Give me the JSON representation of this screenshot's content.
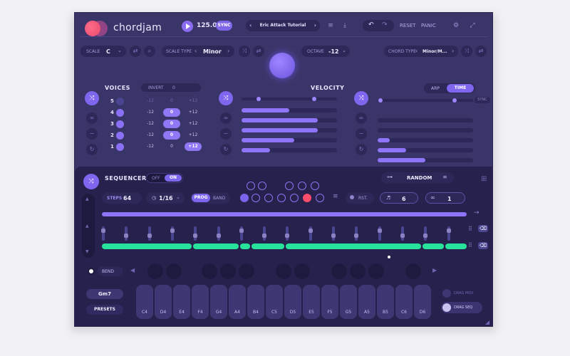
{
  "app": {
    "name": "chordjam"
  },
  "header": {
    "tempo": "125.00",
    "sync_label": "SYNC",
    "preset_name": "Eric Attack Tutorial",
    "reset_label": "RESET",
    "panic_label": "PANIC"
  },
  "controls": {
    "scale_label": "SCALE",
    "scale_value": "C",
    "scale_type_label": "SCALE TYPE",
    "scale_type_value": "Minor",
    "octave_label": "OCTAVE",
    "octave_value": "-12",
    "chord_type_label": "CHORD TYPE",
    "chord_type_value": "Minor/M..."
  },
  "voices": {
    "title": "VOICES",
    "invert_label": "INVERT",
    "invert_value": "0",
    "rows": [
      {
        "num": "5",
        "left": "-12",
        "mid": "0",
        "right": "+12",
        "on": false
      },
      {
        "num": "4",
        "left": "-12",
        "mid": "0",
        "right": "+12",
        "on": true
      },
      {
        "num": "3",
        "left": "-12",
        "mid": "0",
        "right": "+12",
        "on": true
      },
      {
        "num": "2",
        "left": "-12",
        "mid": "0",
        "right": "+12",
        "on": true
      },
      {
        "num": "1",
        "left": "-12",
        "mid": "0",
        "right": "+12",
        "on": true
      }
    ]
  },
  "velocity": {
    "title": "VELOCITY",
    "levels": [
      0.5,
      0.8,
      0.8,
      0.55,
      0.3
    ]
  },
  "arp": {
    "arp_label": "ARP",
    "time_label": "TIME",
    "sync_label": "SYNC",
    "levels": [
      0.0,
      0.0,
      0.13,
      0.3,
      0.5
    ]
  },
  "sequencer": {
    "title": "SEQUENCER",
    "off_label": "OFF",
    "on_label": "ON",
    "mode_label": "RANDOM",
    "steps_label": "STEPS",
    "steps_value": "64",
    "quantize_value": "1/16",
    "prog_label": "PROG",
    "band_label": "BAND",
    "rst_label": "RST.",
    "rate_value": "6",
    "loop_value": "1",
    "bend_label": "BEND",
    "chord_display": "Gm7",
    "presets_label": "PRESETS",
    "drag_midi_label": "DRAG MIDI",
    "drag_seq_label": "DRAG SEQ",
    "keys": [
      "C4",
      "D4",
      "E4",
      "F4",
      "G4",
      "A4",
      "B4",
      "C5",
      "D5",
      "E5",
      "F5",
      "G5",
      "A5",
      "B5",
      "C6",
      "D6"
    ]
  }
}
